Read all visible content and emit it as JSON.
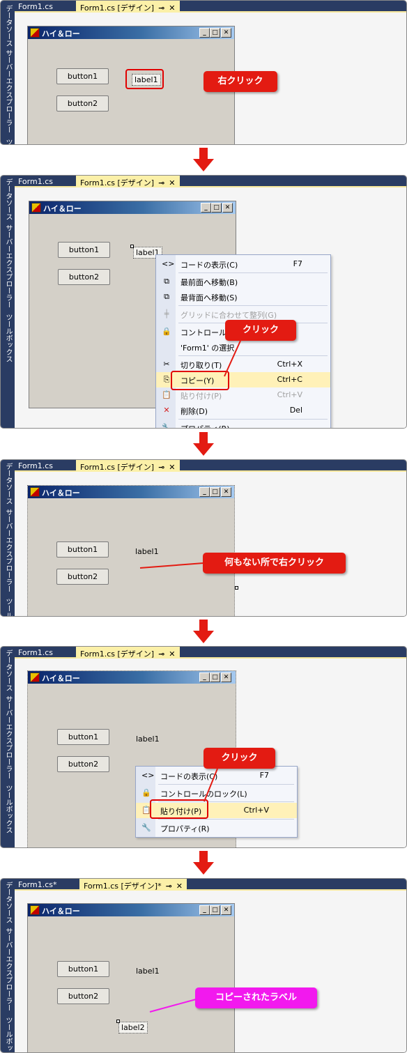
{
  "sidebar": {
    "data_sources": "データソース",
    "server_explorer": "サーバーエクスプローラー",
    "toolbox": "ツールボックス"
  },
  "tabs": {
    "code": "Form1.cs",
    "design": "Form1.cs [デザイン]",
    "code_modified": "Form1.cs*",
    "design_modified": "Form1.cs [デザイン]*",
    "pin": "⊸",
    "close": "✕"
  },
  "form": {
    "title": "ハイ＆ロー",
    "min": "_",
    "max": "□",
    "close": "✕"
  },
  "controls": {
    "button1": "button1",
    "button2": "button2",
    "label1": "label1",
    "label2": "label2"
  },
  "callouts": {
    "step1": "右クリック",
    "step2": "クリック",
    "step3": "何もない所で右クリック",
    "step4": "クリック",
    "step5": "コピーされたラベル"
  },
  "menu1": [
    {
      "icon": "<>",
      "label": "コードの表示(C)",
      "shortcut": "F7",
      "disabled": false
    },
    {
      "icon": "⧉",
      "label": "最前面へ移動(B)",
      "shortcut": "",
      "disabled": false
    },
    {
      "icon": "⧉",
      "label": "最背面へ移動(S)",
      "shortcut": "",
      "disabled": false
    },
    {
      "icon": "╪",
      "label": "グリッドに合わせて整列(G)",
      "shortcut": "",
      "disabled": true
    },
    {
      "icon": "🔒",
      "label": "コントロールのロック(L)",
      "shortcut": "",
      "disabled": false
    },
    {
      "icon": "",
      "label": "'Form1' の選択",
      "shortcut": "",
      "disabled": false
    },
    {
      "icon": "✂",
      "label": "切り取り(T)",
      "shortcut": "Ctrl+X",
      "disabled": false
    },
    {
      "icon": "⎘",
      "label": "コピー(Y)",
      "shortcut": "Ctrl+C",
      "disabled": false
    },
    {
      "icon": "📋",
      "label": "貼り付け(P)",
      "shortcut": "Ctrl+V",
      "disabled": true
    },
    {
      "icon": "✕",
      "label": "削除(D)",
      "shortcut": "Del",
      "disabled": false
    },
    {
      "icon": "🔧",
      "label": "プロパティ(R)",
      "shortcut": "",
      "disabled": false
    }
  ],
  "menu2": [
    {
      "icon": "<>",
      "label": "コードの表示(C)",
      "shortcut": "F7"
    },
    {
      "icon": "🔒",
      "label": "コントロールのロック(L)",
      "shortcut": ""
    },
    {
      "icon": "📋",
      "label": "貼り付け(P)",
      "shortcut": "Ctrl+V"
    },
    {
      "icon": "🔧",
      "label": "プロパティ(R)",
      "shortcut": ""
    }
  ],
  "colors": {
    "callout_red": "#e31b12",
    "callout_magenta": "#f219ee",
    "highlight": "#fff1b8",
    "tab_bar": "#2a3c63",
    "form_bg": "#d4d0c8"
  }
}
